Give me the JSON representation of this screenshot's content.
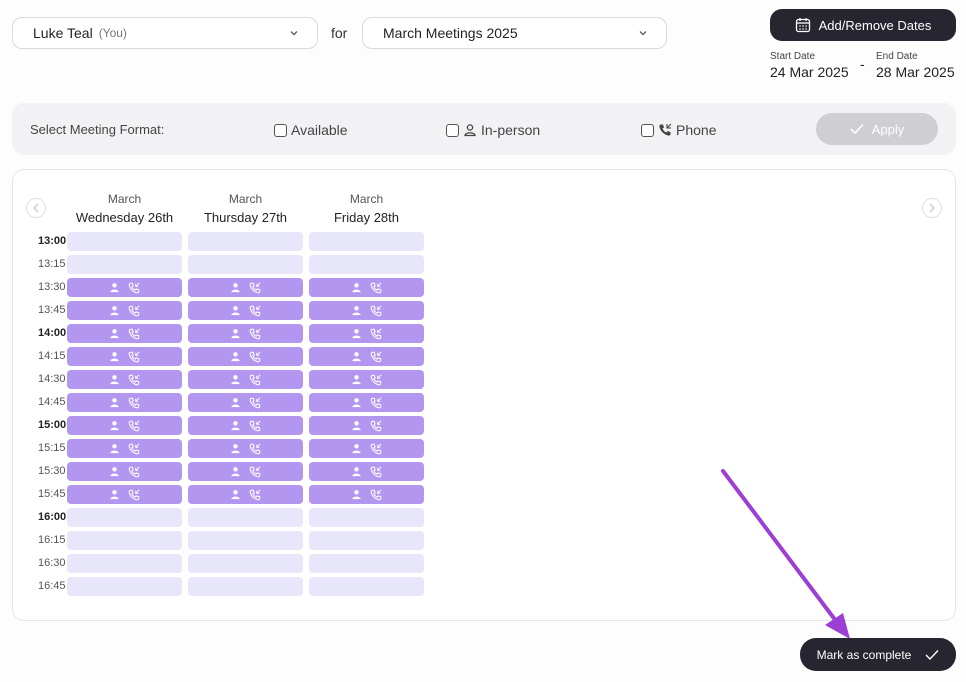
{
  "header": {
    "user_select": {
      "name": "Luke Teal",
      "suffix": "(You)"
    },
    "for_label": "for",
    "meeting_select": {
      "value": "March Meetings 2025"
    },
    "add_remove_label": "Add/Remove Dates",
    "start_date": {
      "label": "Start Date",
      "value": "24 Mar 2025"
    },
    "date_separator": "-",
    "end_date": {
      "label": "End Date",
      "value": "28 Mar 2025"
    }
  },
  "filter": {
    "title": "Select Meeting Format:",
    "options": [
      {
        "label": "Available",
        "icon": "",
        "checked": false
      },
      {
        "label": "In-person",
        "icon": "person-icon",
        "checked": false
      },
      {
        "label": "Phone",
        "icon": "phone-icon",
        "checked": false
      }
    ],
    "apply_label": "Apply"
  },
  "schedule": {
    "columns": [
      {
        "month": "March",
        "day": "Wednesday 26th"
      },
      {
        "month": "March",
        "day": "Thursday 27th"
      },
      {
        "month": "March",
        "day": "Friday 28th"
      }
    ],
    "times": [
      {
        "label": "13:00",
        "bold": true,
        "selected": false
      },
      {
        "label": "13:15",
        "bold": false,
        "selected": false
      },
      {
        "label": "13:30",
        "bold": false,
        "selected": true
      },
      {
        "label": "13:45",
        "bold": false,
        "selected": true
      },
      {
        "label": "14:00",
        "bold": true,
        "selected": true
      },
      {
        "label": "14:15",
        "bold": false,
        "selected": true
      },
      {
        "label": "14:30",
        "bold": false,
        "selected": true
      },
      {
        "label": "14:45",
        "bold": false,
        "selected": true
      },
      {
        "label": "15:00",
        "bold": true,
        "selected": true
      },
      {
        "label": "15:15",
        "bold": false,
        "selected": true
      },
      {
        "label": "15:30",
        "bold": false,
        "selected": true
      },
      {
        "label": "15:45",
        "bold": false,
        "selected": true
      },
      {
        "label": "16:00",
        "bold": true,
        "selected": false
      },
      {
        "label": "16:15",
        "bold": false,
        "selected": false
      },
      {
        "label": "16:30",
        "bold": false,
        "selected": false
      },
      {
        "label": "16:45",
        "bold": false,
        "selected": false
      }
    ],
    "selected_slot_icons": [
      "person-icon",
      "phone-icon"
    ]
  },
  "footer": {
    "mark_complete_label": "Mark as complete"
  },
  "colors": {
    "accent_dark": "#262530",
    "slot_selected": "#b296f0",
    "slot_empty": "#e8e6fb",
    "annotation_arrow": "#9b3fd6"
  }
}
